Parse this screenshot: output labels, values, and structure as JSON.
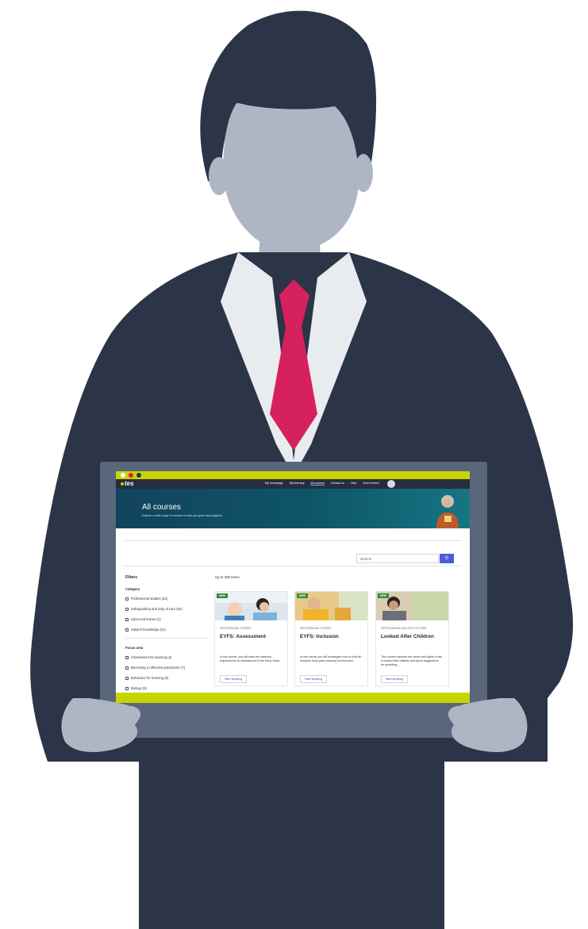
{
  "colors": {
    "accent_lime": "#c8d400",
    "tie": "#d6215f",
    "suit": "#2b3547",
    "skin": "#aeb6c3",
    "laptop_frame": "#5a667c",
    "nav_bg": "#262d3f",
    "search_button": "#4e5bd8"
  },
  "window_dots": [
    "#ffffff",
    "#e2203a",
    "#2b3547"
  ],
  "nav": {
    "logo": "tes",
    "links": [
      "My homepage",
      "My learning",
      "All courses",
      "Contact us",
      "Help"
    ],
    "active": "All courses",
    "user": "Zeed Konsel"
  },
  "hero": {
    "title": "All courses",
    "subtitle": "Explore a wide range of courses to help you grow and progress."
  },
  "search": {
    "placeholder": "Search",
    "button_icon": "search-icon"
  },
  "filters": {
    "title": "Filters",
    "groups": [
      {
        "heading": "Category",
        "options": [
          "Professional studies (33)",
          "Safeguarding and duty of care (92)",
          "Sport and leisure (1)",
          "Subject knowledge (51)"
        ]
      },
      {
        "heading": "Focus area",
        "options": [
          "Assessment for learning (4)",
          "Becoming a reflective practitioner (7)",
          "Behaviour for learning (5)",
          "Biology (6)"
        ]
      }
    ]
  },
  "results": {
    "count_label": "Up to 300 items"
  },
  "cards": [
    {
      "badge": "NEW",
      "category": "PROFESSIONAL STUDIES",
      "title": "EYFS: Assessment",
      "description": "In this course, you will learn the statutory requirements for assessment in the Early Years.",
      "button": "Start studying"
    },
    {
      "badge": "NEW",
      "category": "PROFESSIONAL STUDIES",
      "title": "EYFS: Inclusion",
      "description": "In this course you will investigate how to build an inclusive early years learning environment.",
      "button": "Start studying"
    },
    {
      "badge": "NEW",
      "category": "SAFEGUARDING AND DUTY OF CARE",
      "title": "Looked After Children",
      "description": "This course explores the needs and rights in law of looked after children and gives suggestions for providing...",
      "button": "Start studying"
    }
  ]
}
